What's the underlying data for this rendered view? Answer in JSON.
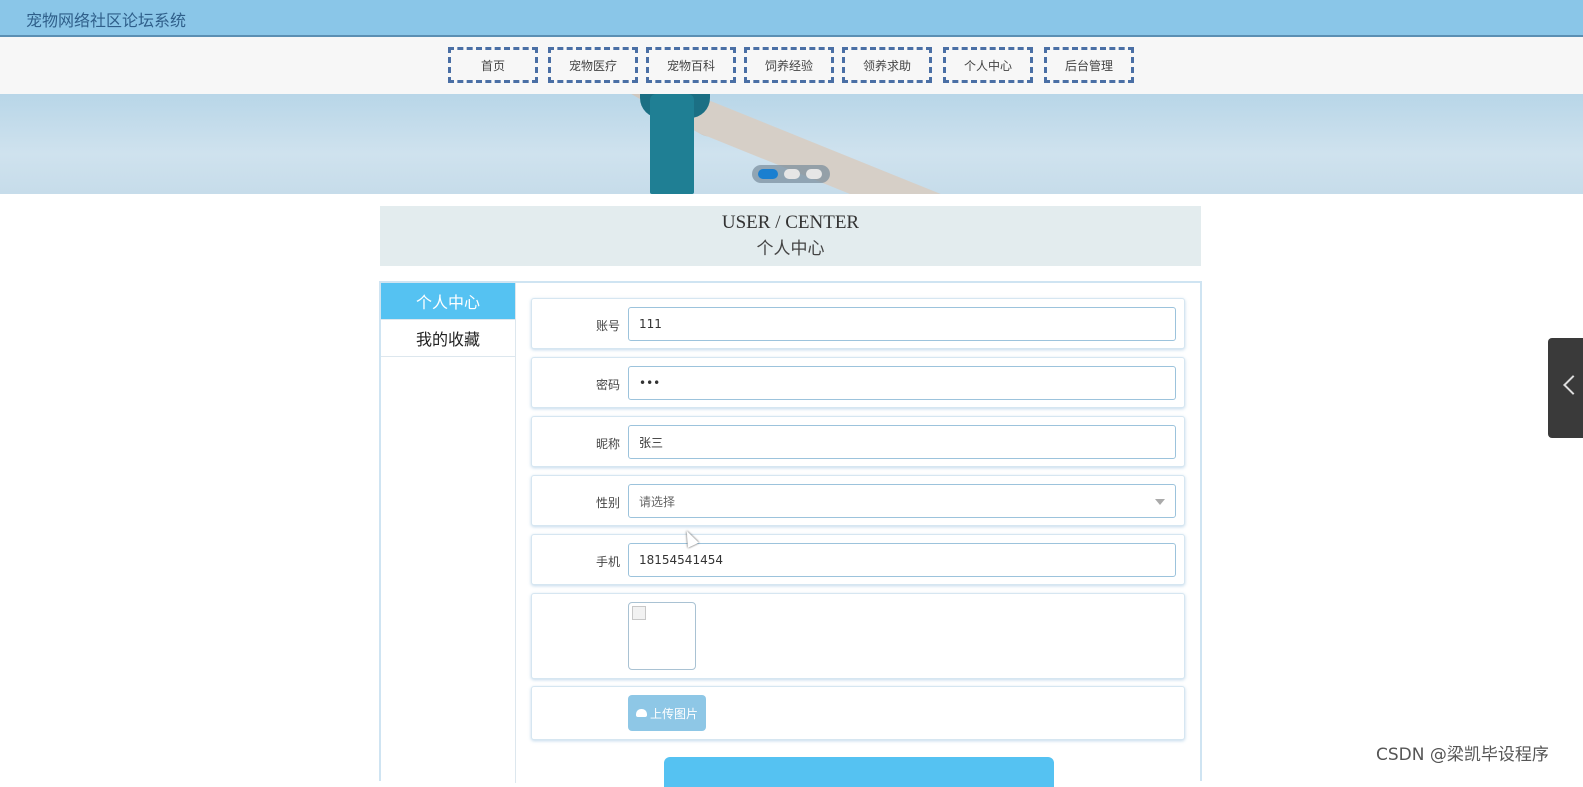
{
  "header": {
    "title": "宠物网络社区论坛系统"
  },
  "nav": {
    "items": [
      {
        "label": "首页"
      },
      {
        "label": "宠物医疗"
      },
      {
        "label": "宠物百科"
      },
      {
        "label": "饲养经验"
      },
      {
        "label": "领养求助"
      },
      {
        "label": "个人中心"
      },
      {
        "label": "后台管理"
      }
    ]
  },
  "banner": {
    "slides": 3,
    "active_slide": 1
  },
  "section": {
    "title_en": "USER / CENTER",
    "title_cn": "个人中心"
  },
  "sidebar": {
    "items": [
      {
        "label": "个人中心",
        "active": true
      },
      {
        "label": "我的收藏",
        "active": false
      }
    ]
  },
  "form": {
    "account": {
      "label": "账号",
      "value": "111"
    },
    "password": {
      "label": "密码",
      "value": "•••"
    },
    "nickname": {
      "label": "昵称",
      "value": "张三"
    },
    "gender": {
      "label": "性别",
      "placeholder": "请选择"
    },
    "phone": {
      "label": "手机",
      "value": "18154541454"
    },
    "upload": {
      "label": "上传图片"
    }
  },
  "watermark": "CSDN @梁凯毕设程序",
  "colors": {
    "topbar": "#8ac6e8",
    "accent": "#55c2f2",
    "nav_border": "#4a6fa5"
  }
}
